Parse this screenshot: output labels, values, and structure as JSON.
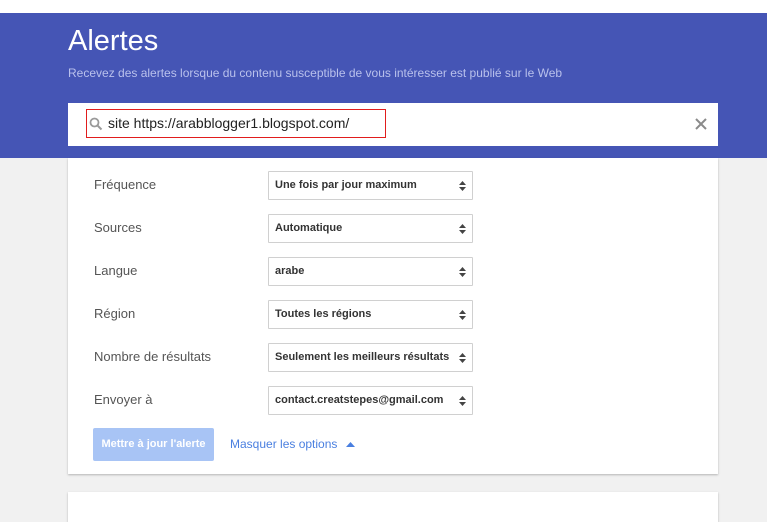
{
  "header": {
    "title": "Alertes",
    "subtitle": "Recevez des alertes lorsque du contenu susceptible de vous intéresser est publié sur le Web",
    "background_color": "#4555b5"
  },
  "search": {
    "query": "site https://arabblogger1.blogspot.com/",
    "search_icon": "search-icon",
    "clear_icon": "close-icon",
    "highlight_color": "#e11d1d"
  },
  "options": [
    {
      "label": "Fréquence",
      "value": "Une fois par jour maximum"
    },
    {
      "label": "Sources",
      "value": "Automatique"
    },
    {
      "label": "Langue",
      "value": "arabe"
    },
    {
      "label": "Région",
      "value": "Toutes les régions"
    },
    {
      "label": "Nombre de résultats",
      "value": "Seulement les meilleurs résultats"
    },
    {
      "label": "Envoyer à",
      "value": "contact.creatstepes@gmail.com"
    }
  ],
  "actions": {
    "update_label": "Mettre à jour l'alerte",
    "toggle_options_label": "Masquer les options",
    "toggle_icon": "caret-up-icon",
    "link_color": "#4a7fe0",
    "button_color": "#a8c4f5"
  }
}
